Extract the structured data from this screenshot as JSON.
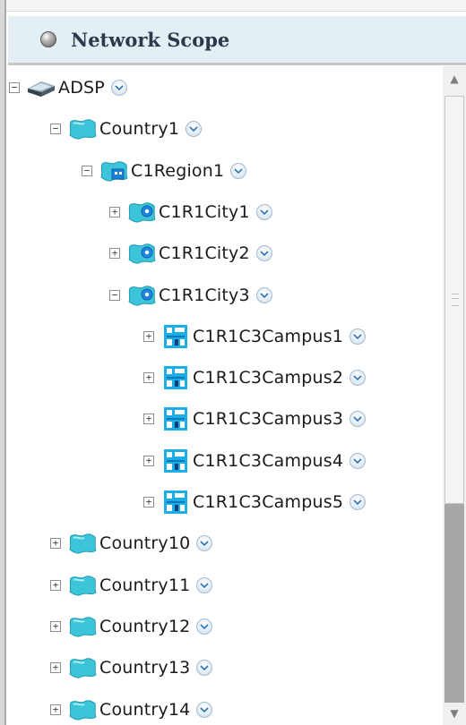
{
  "header": {
    "title": "Network Scope",
    "icon": "status-dot-icon"
  },
  "tree": [
    {
      "label": "ADSP",
      "depth": 0,
      "toggle": "minus",
      "icon": "server-icon"
    },
    {
      "label": "Country1",
      "depth": 1,
      "toggle": "minus",
      "icon": "country-icon"
    },
    {
      "label": "C1Region1",
      "depth": 2,
      "toggle": "minus",
      "icon": "region-icon"
    },
    {
      "label": "C1R1City1",
      "depth": 3,
      "toggle": "plus",
      "icon": "city-icon"
    },
    {
      "label": "C1R1City2",
      "depth": 3,
      "toggle": "plus",
      "icon": "city-icon"
    },
    {
      "label": "C1R1City3",
      "depth": 3,
      "toggle": "minus",
      "icon": "city-icon"
    },
    {
      "label": "C1R1C3Campus1",
      "depth": 4,
      "toggle": "plus",
      "icon": "campus-icon"
    },
    {
      "label": "C1R1C3Campus2",
      "depth": 4,
      "toggle": "plus",
      "icon": "campus-icon"
    },
    {
      "label": "C1R1C3Campus3",
      "depth": 4,
      "toggle": "plus",
      "icon": "campus-icon"
    },
    {
      "label": "C1R1C3Campus4",
      "depth": 4,
      "toggle": "plus",
      "icon": "campus-icon"
    },
    {
      "label": "C1R1C3Campus5",
      "depth": 4,
      "toggle": "plus",
      "icon": "campus-icon"
    },
    {
      "label": "Country10",
      "depth": 1,
      "toggle": "plus",
      "icon": "country-icon"
    },
    {
      "label": "Country11",
      "depth": 1,
      "toggle": "plus",
      "icon": "country-icon"
    },
    {
      "label": "Country12",
      "depth": 1,
      "toggle": "plus",
      "icon": "country-icon"
    },
    {
      "label": "Country13",
      "depth": 1,
      "toggle": "plus",
      "icon": "country-icon"
    },
    {
      "label": "Country14",
      "depth": 1,
      "toggle": "plus",
      "icon": "country-icon"
    }
  ],
  "colors": {
    "header_bg": "#e4eef5",
    "country_icon": "#3cc4d9",
    "campus_icon": "#19aee8",
    "menu_button": "#dde8f3",
    "scroll_thumb": "#a7a7a7"
  },
  "scroll": {
    "thumb_icon": "grip-icon",
    "up_icon": "scroll-up-icon",
    "down_icon": "scroll-down-icon"
  }
}
